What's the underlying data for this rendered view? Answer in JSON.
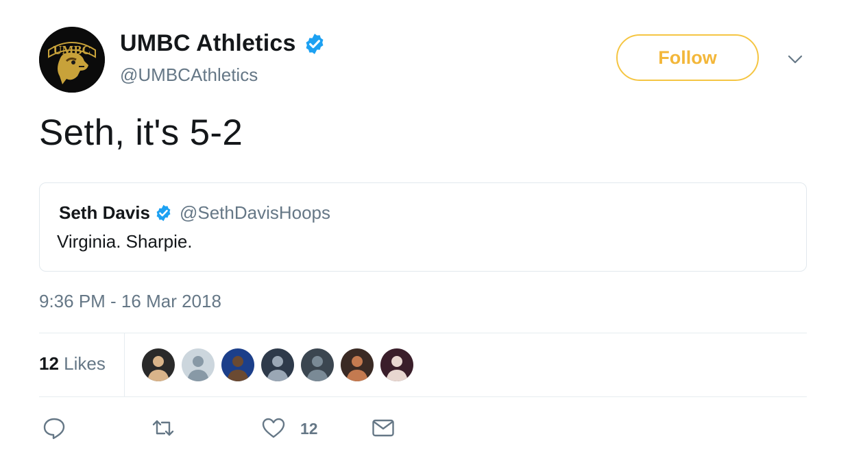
{
  "author": {
    "name": "UMBC Athletics",
    "handle": "@UMBCAthletics",
    "avatar_text": "UMBC"
  },
  "follow_label": "Follow",
  "tweet": {
    "text": "Seth, it's 5-2",
    "timestamp": "9:36 PM - 16 Mar 2018"
  },
  "quoted": {
    "name": "Seth Davis",
    "handle": "@SethDavisHoops",
    "text": "Virginia. Sharpie."
  },
  "stats": {
    "likes_count": "12",
    "likes_label": "Likes"
  },
  "actions": {
    "like_count": "12"
  },
  "likers": [
    {
      "bg": "#2a2a2a",
      "fg": "#d9b48a"
    },
    {
      "bg": "#ccd6dd",
      "fg": "#8899a6"
    },
    {
      "bg": "#1c3f8a",
      "fg": "#6b4a32"
    },
    {
      "bg": "#2e3a4a",
      "fg": "#9aa7b5"
    },
    {
      "bg": "#3b4650",
      "fg": "#7a8a96"
    },
    {
      "bg": "#3a2a24",
      "fg": "#c47a50"
    },
    {
      "bg": "#3a1e2a",
      "fg": "#e8d7d0"
    }
  ],
  "colors": {
    "verified": "#1da1f2",
    "follow_accent": "#f3b73a",
    "secondary_text": "#657786"
  }
}
